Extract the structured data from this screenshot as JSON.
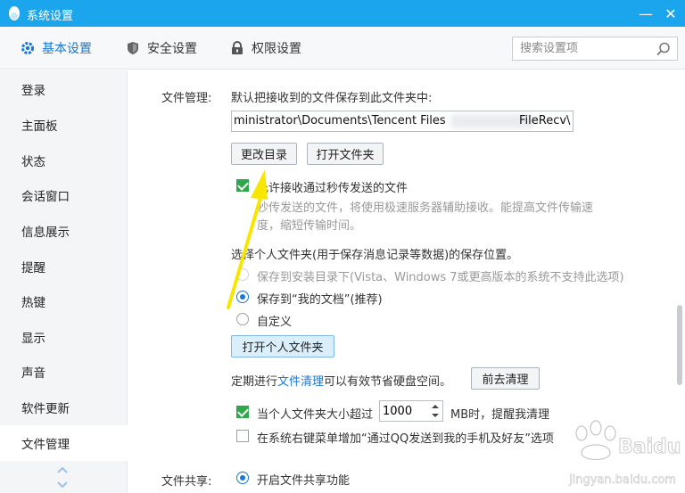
{
  "window": {
    "title": "系统设置",
    "logo_icon": "penguin-icon",
    "minimize_glyph": "—",
    "close_glyph": "✕"
  },
  "tabs": [
    {
      "label": "基本设置",
      "icon": "gear-icon",
      "active": true
    },
    {
      "label": "安全设置",
      "icon": "shield-icon",
      "active": false
    },
    {
      "label": "权限设置",
      "icon": "lock-icon",
      "active": false
    }
  ],
  "search": {
    "placeholder": "搜索设置项",
    "icon": "search-icon"
  },
  "sidebar": {
    "items": [
      {
        "label": "登录"
      },
      {
        "label": "主面板"
      },
      {
        "label": "状态"
      },
      {
        "label": "会话窗口"
      },
      {
        "label": "信息展示"
      },
      {
        "label": "提醒"
      },
      {
        "label": "热键"
      },
      {
        "label": "显示"
      },
      {
        "label": "声音"
      },
      {
        "label": "软件更新"
      },
      {
        "label": "文件管理",
        "active": true
      }
    ]
  },
  "file_mgmt": {
    "section_label": "文件管理:",
    "desc": "默认把接收到的文件保存到此文件夹中:",
    "path_value": "ministrator\\Documents\\Tencent Files",
    "path_tail": "FileRecv\\",
    "change_dir_button": "更改目录",
    "open_folder_button": "打开文件夹",
    "allow_receive_label": "允许接收通过秒传发送的文件",
    "allow_receive_desc_line1": "秒传发送的文件，将使用极速服务器辅助接收。能提高文件传输速",
    "allow_receive_desc_line2": "度，缩短传输时间。",
    "personal_folder_heading": "选择个人文件夹(用于保存消息记录等数据)的保存位置。",
    "radio_install_dir": "保存到安装目录下(Vista、Windows 7或更高版本的系统不支持此选项)",
    "radio_my_docs": "保存到“我的文档”(推荐)",
    "radio_custom": "自定义",
    "open_personal_folder_button": "打开个人文件夹",
    "cleanup_text_before": "定期进行",
    "cleanup_link": "文件清理",
    "cleanup_text_after": "可以有效节省硬盘空间。",
    "go_cleanup_button": "前去清理",
    "size_remind_label_before": "当个人文件夹大小超过",
    "size_value": "1000",
    "size_remind_label_after": "MB时，提醒我清理",
    "context_menu_label": "在系统右键菜单增加“通过QQ发送到我的手机及好友”选项"
  },
  "file_share": {
    "section_label": "文件共享:",
    "enable_label": "开启文件共享功能"
  },
  "watermark": {
    "line1": "Baidu 经验",
    "line2": "jingyan.baidu.com"
  },
  "colors": {
    "accent": "#1aa5ec",
    "link": "#1a77d2",
    "check": "#2ea84a",
    "annotation_arrow": "#f7e600"
  }
}
